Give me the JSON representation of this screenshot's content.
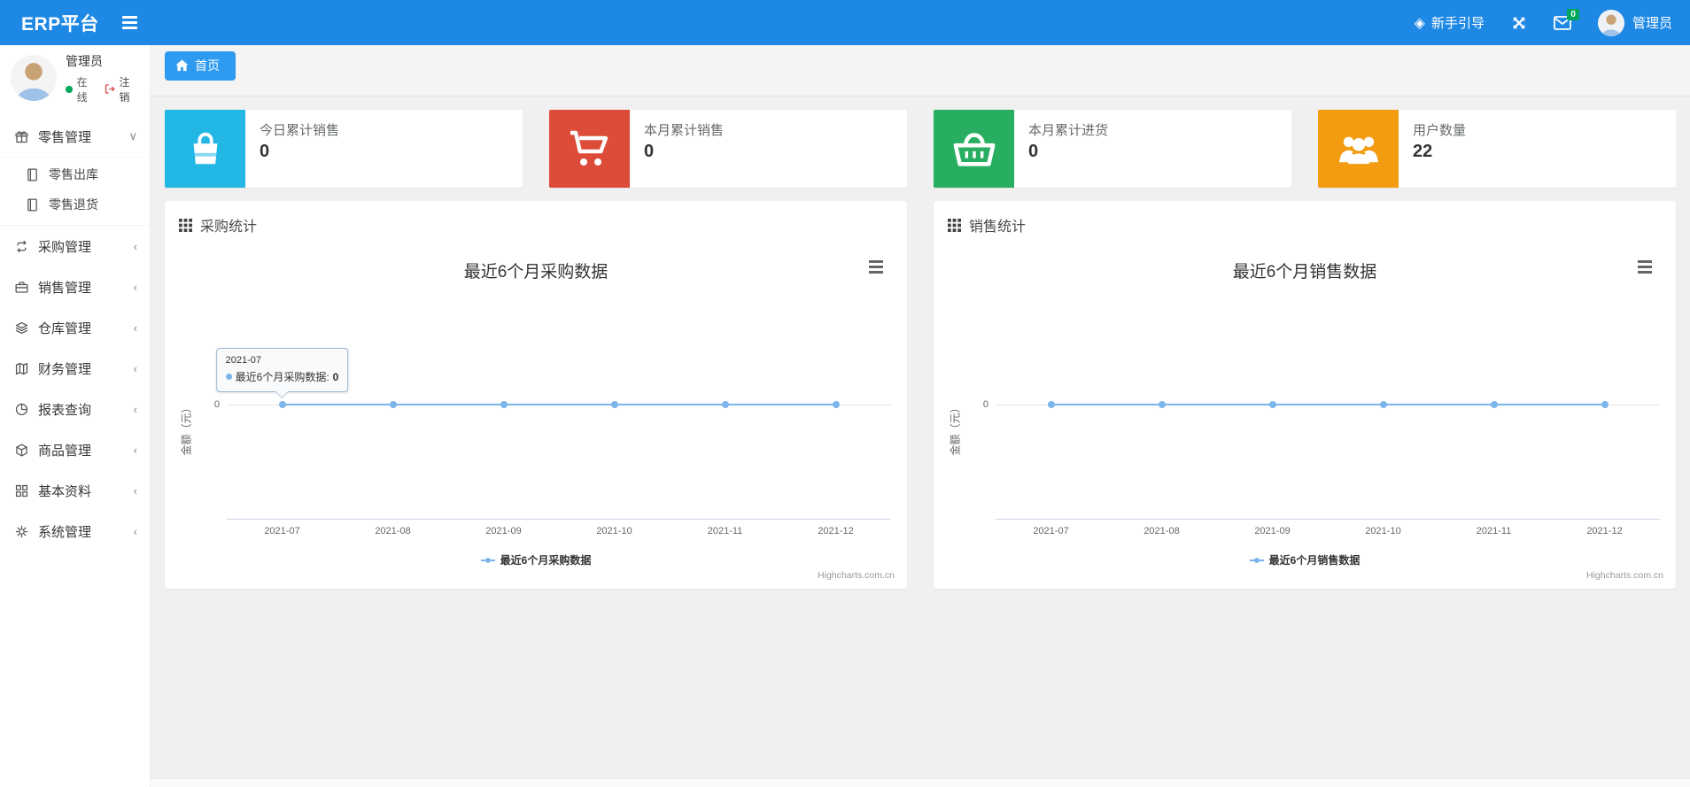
{
  "colors": {
    "navbar": "#1e88e5",
    "breadcrumb_tab": "#2e9af0",
    "badge_green": "#00a65a",
    "series_blue": "#7cb5ec"
  },
  "navbar": {
    "brand": "ERP平台",
    "guide_label": "新手引导",
    "mail_badge": "0",
    "user_name": "管理员"
  },
  "sidebar": {
    "user": {
      "name": "管理员",
      "status": "在线",
      "logout": "注销"
    },
    "menu": [
      {
        "label": "零售管理",
        "icon": "gift-icon",
        "state": "expanded",
        "children": [
          {
            "label": "零售出库",
            "icon": "journal-icon"
          },
          {
            "label": "零售退货",
            "icon": "journal-icon"
          }
        ]
      },
      {
        "label": "采购管理",
        "icon": "repeat-icon",
        "state": "collapsed"
      },
      {
        "label": "销售管理",
        "icon": "briefcase-icon",
        "state": "collapsed"
      },
      {
        "label": "仓库管理",
        "icon": "layers-icon",
        "state": "collapsed"
      },
      {
        "label": "财务管理",
        "icon": "map-icon",
        "state": "collapsed"
      },
      {
        "label": "报表查询",
        "icon": "pie-icon",
        "state": "collapsed"
      },
      {
        "label": "商品管理",
        "icon": "box-icon",
        "state": "collapsed"
      },
      {
        "label": "基本资料",
        "icon": "grid-icon",
        "state": "collapsed"
      },
      {
        "label": "系统管理",
        "icon": "gear-icon",
        "state": "collapsed"
      }
    ]
  },
  "breadcrumb": {
    "label": "首页"
  },
  "stat_cards": [
    {
      "title": "今日累计销售",
      "value": "0",
      "icon": "shopping-bag-icon",
      "color": "#23b7e5"
    },
    {
      "title": "本月累计销售",
      "value": "0",
      "icon": "shopping-cart-icon",
      "color": "#dd4b39"
    },
    {
      "title": "本月累计进货",
      "value": "0",
      "icon": "shopping-basket-icon",
      "color": "#27ae60"
    },
    {
      "title": "用户数量",
      "value": "22",
      "icon": "users-icon",
      "color": "#f39c12"
    }
  ],
  "panels": [
    {
      "header": "采购统计"
    },
    {
      "header": "销售统计"
    }
  ],
  "chart_data": [
    {
      "type": "line",
      "title": "最近6个月采购数据",
      "categories": [
        "2021-07",
        "2021-08",
        "2021-09",
        "2021-10",
        "2021-11",
        "2021-12"
      ],
      "series": [
        {
          "name": "最近6个月采购数据",
          "values": [
            0,
            0,
            0,
            0,
            0,
            0
          ],
          "color": "#7cb5ec"
        }
      ],
      "xlabel": "",
      "ylabel": "金额（元）",
      "yticks": [
        "0"
      ],
      "grid": true,
      "legend_position": "bottom",
      "credit": "Highcharts.com.cn",
      "tooltip": {
        "title": "2021-07",
        "label": "最近6个月采购数据:",
        "value": "0",
        "point_index": 0
      }
    },
    {
      "type": "line",
      "title": "最近6个月销售数据",
      "categories": [
        "2021-07",
        "2021-08",
        "2021-09",
        "2021-10",
        "2021-11",
        "2021-12"
      ],
      "series": [
        {
          "name": "最近6个月销售数据",
          "values": [
            0,
            0,
            0,
            0,
            0,
            0
          ],
          "color": "#7cb5ec"
        }
      ],
      "xlabel": "",
      "ylabel": "金额（元）",
      "yticks": [
        "0"
      ],
      "grid": true,
      "legend_position": "bottom",
      "credit": "Highcharts.com.cn",
      "tooltip": null
    }
  ]
}
